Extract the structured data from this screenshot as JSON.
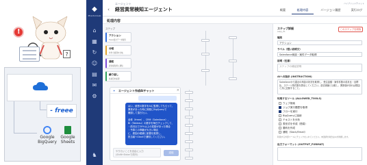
{
  "illustration": {
    "warning_badge": "!",
    "question_mark": "?",
    "freee_logo": "- freee",
    "bigquery_label": "Google BigQuery",
    "sheets_label": "Google Sheets"
  },
  "sidebar": {
    "brand": "PhantomLab",
    "icons": [
      "home-icon",
      "grid-icon",
      "refresh-icon",
      "users-icon",
      "chart-icon",
      "mail-icon",
      "settings-icon",
      "deer-icon"
    ]
  },
  "header": {
    "breadcrumb": "エージェント",
    "title": "経営異常検知エージェント",
    "top_note": "ハイブリッドチャット",
    "tabs": [
      {
        "label": "概要"
      },
      {
        "label": "処理内容",
        "active": true
      },
      {
        "label": "バージョン履歴"
      },
      {
        "label": "実行ログ"
      }
    ]
  },
  "section": {
    "title": "処理内容"
  },
  "canvas": {
    "nodes_label": "ステップ",
    "nodes": [
      {
        "title": "アクション",
        "desc": "freee会計データ取得"
      },
      {
        "title": "分岐",
        "desc": "条件で処理を分岐"
      },
      {
        "title": "通知",
        "desc": "異常検知時に通知"
      },
      {
        "title": "繰り返し",
        "desc": "各項目を処理"
      }
    ]
  },
  "chat": {
    "title": "エージェント作成AIチャット",
    "bubble_lines": [
      "はい、経営の数字をAIに監視してもらって、",
      "異常があった時に即座にBigQueryで",
      "確認して頂きたい。",
      "",
      "全体（freee）、CRM（Salesforce）、",
      "BI（Tableau）の数字を毎日チェックして、",
      "・前月比で20%以上の変動があった場合",
      "・予算との乖離が大きい場合",
      "に、原因の候補と影響を推測し、",
      "担当者へSlackで通知してください。"
    ],
    "input_placeholder": "やりたいことを自由に入力 (Shift+Enterで改行)",
    "send_label": "送信"
  },
  "panel": {
    "title": "ステップ詳細",
    "subtitle": "step_01",
    "danger_label": "このステップを削除",
    "type_label": "種別",
    "type_value": "アクション",
    "name_label": "ラベル（短い説明文）",
    "name_value": "Salesforce商談・案件データ取得",
    "desc_label": "説明（任意）",
    "desc_placeholder": "ステップの補足説明",
    "instruction_label": "AIへの指示 (INSTRUCTION)",
    "instruction_text": "Salesforceから直近の商談の状況を取得し、受注金額・案件件数の前月比・目標比、ステージ別件数を算出してください。過去実績と比較し、異常値があれば理由と共に記録すること。",
    "tools_label": "利用するツール (ALLOWED_TOOLS)",
    "tools": [
      {
        "label": "ウェブ検索",
        "checked": false
      },
      {
        "label": "ジョブ実行履歴を取得",
        "checked": true
      },
      {
        "label": "フローを実行",
        "checked": true
      },
      {
        "label": "BigQueryに接続",
        "checked": false
      },
      {
        "label": "テキストを分析",
        "checked": false
      },
      {
        "label": "表形式を作成（簡易）",
        "checked": false
      },
      {
        "label": "要約を作成",
        "checked": false
      },
      {
        "label": "通知（Slack/Email）",
        "checked": false
      }
    ],
    "tools_hint": "利用する外部ツールにチェックを入れてください。未選択の場合はAIが判断します。",
    "output_label": "出力フォーマット (OUTPUT_FORMAT)"
  }
}
